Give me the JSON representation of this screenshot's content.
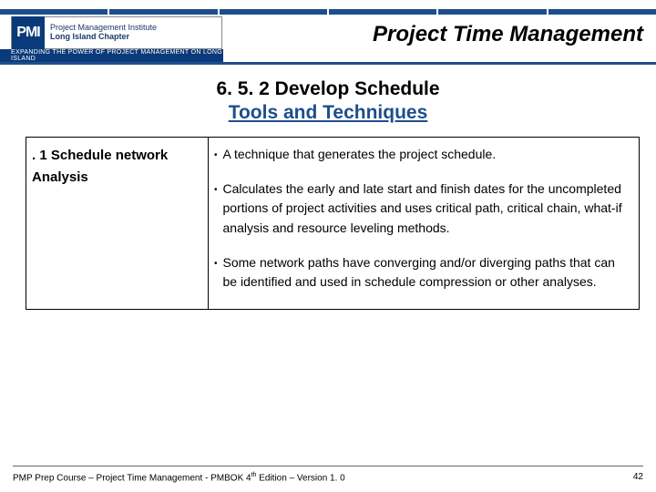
{
  "header": {
    "logo_initials": "PMI",
    "logo_line1": "Project Management Institute",
    "logo_line2": "Long Island Chapter",
    "tagline": "EXPANDING THE POWER OF PROJECT MANAGEMENT ON LONG ISLAND",
    "title": "Project Time Management"
  },
  "section": {
    "number_label": "6. 5. 2  Develop Schedule",
    "subtitle": "Tools and Techniques"
  },
  "table": {
    "left": ". 1 Schedule network Analysis",
    "bullets": [
      "A technique that generates the project schedule.",
      "Calculates the early and late start and finish dates for the uncompleted portions of project activities and uses critical path, critical chain, what-if analysis and resource leveling methods.",
      "Some network paths have converging and/or diverging paths that can be identified and used in schedule compression or other analyses."
    ]
  },
  "footer": {
    "left_prefix": "PMP Prep Course – Project Time Management - PMBOK 4",
    "left_sup": "th",
    "left_suffix": " Edition – Version 1. 0",
    "page": "42"
  }
}
